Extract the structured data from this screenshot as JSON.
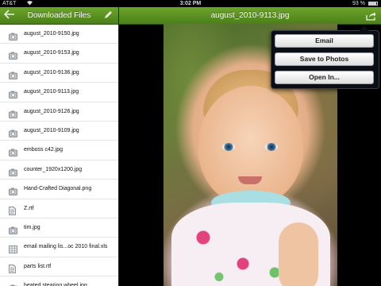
{
  "status_bar": {
    "carrier": "AT&T",
    "wifi_icon": "wifi-icon",
    "time": "3:02 PM",
    "battery": "93 %"
  },
  "sidebar": {
    "title": "Downloaded Files",
    "back_icon": "back-arrow-icon",
    "edit_icon": "pencil-icon",
    "files": [
      {
        "name": "august_2010-9150.jpg",
        "icon": "camera-icon"
      },
      {
        "name": "august_2010-9153.jpg",
        "icon": "camera-icon"
      },
      {
        "name": "august_2010-9136.jpg",
        "icon": "camera-icon"
      },
      {
        "name": "august_2010-9113.jpg",
        "icon": "camera-icon"
      },
      {
        "name": "august_2010-9126.jpg",
        "icon": "camera-icon"
      },
      {
        "name": "august_2010-9109.jpg",
        "icon": "camera-icon"
      },
      {
        "name": "emboss c42.jpg",
        "icon": "camera-icon"
      },
      {
        "name": "counter_1920x1200.jpg",
        "icon": "camera-icon"
      },
      {
        "name": "Hand-Crafted Diagonal.png",
        "icon": "camera-icon"
      },
      {
        "name": "Z.rtf",
        "icon": "document-icon"
      },
      {
        "name": "tim.jpg",
        "icon": "camera-icon"
      },
      {
        "name": "email mailing lis...oc 2010 final.xls",
        "icon": "spreadsheet-icon"
      },
      {
        "name": "parts list.rtf",
        "icon": "document-icon"
      },
      {
        "name": "heated stearing wheel.jpg",
        "icon": "camera-icon"
      }
    ]
  },
  "viewer": {
    "title": "august_2010-9113.jpg",
    "share_icon": "share-icon"
  },
  "popover": {
    "email_label": "Email",
    "save_label": "Save to Photos",
    "open_label": "Open In..."
  }
}
